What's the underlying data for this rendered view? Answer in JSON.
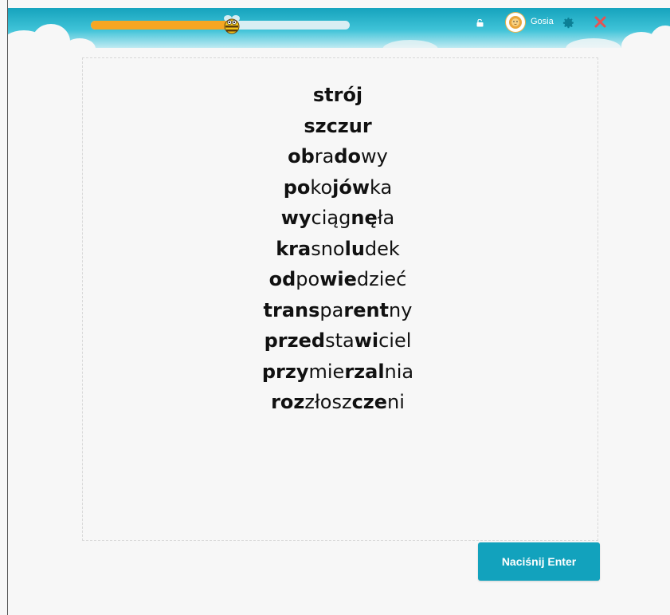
{
  "header": {
    "progress": 0.54,
    "user_name": "Gosia",
    "colors": {
      "header": "#16a3bd",
      "progress_fill": "#f6a623",
      "progress_track": "#d9eef3",
      "close": "#e55353",
      "gear": "#0b7f95"
    },
    "icons": [
      "bee-icon",
      "lock-icon",
      "avatar",
      "gear-icon",
      "close-icon"
    ]
  },
  "words": [
    [
      {
        "t": "strój",
        "b": true
      }
    ],
    [
      {
        "t": "szczur",
        "b": true
      }
    ],
    [
      {
        "t": "ob",
        "b": true
      },
      {
        "t": "ra",
        "b": false
      },
      {
        "t": "do",
        "b": true
      },
      {
        "t": "wy",
        "b": false
      }
    ],
    [
      {
        "t": "po",
        "b": true
      },
      {
        "t": "ko",
        "b": false
      },
      {
        "t": "jów",
        "b": true
      },
      {
        "t": "ka",
        "b": false
      }
    ],
    [
      {
        "t": "wy",
        "b": true
      },
      {
        "t": "ciąg",
        "b": false
      },
      {
        "t": "nę",
        "b": true
      },
      {
        "t": "ła",
        "b": false
      }
    ],
    [
      {
        "t": "kra",
        "b": true
      },
      {
        "t": "sno",
        "b": false
      },
      {
        "t": "lu",
        "b": true
      },
      {
        "t": "dek",
        "b": false
      }
    ],
    [
      {
        "t": "od",
        "b": true
      },
      {
        "t": "po",
        "b": false
      },
      {
        "t": "wie",
        "b": true
      },
      {
        "t": "dzieć",
        "b": false
      }
    ],
    [
      {
        "t": "trans",
        "b": true
      },
      {
        "t": "pa",
        "b": false
      },
      {
        "t": "rent",
        "b": true
      },
      {
        "t": "ny",
        "b": false
      }
    ],
    [
      {
        "t": "przed",
        "b": true
      },
      {
        "t": "sta",
        "b": false
      },
      {
        "t": "wi",
        "b": true
      },
      {
        "t": "ciel",
        "b": false
      }
    ],
    [
      {
        "t": "przy",
        "b": true
      },
      {
        "t": "mie",
        "b": false
      },
      {
        "t": "rzal",
        "b": true
      },
      {
        "t": "nia",
        "b": false
      }
    ],
    [
      {
        "t": "roz",
        "b": true
      },
      {
        "t": "złosz",
        "b": false
      },
      {
        "t": "cze",
        "b": true
      },
      {
        "t": "ni",
        "b": false
      }
    ]
  ],
  "footer": {
    "enter_label": "Naciśnij Enter"
  }
}
